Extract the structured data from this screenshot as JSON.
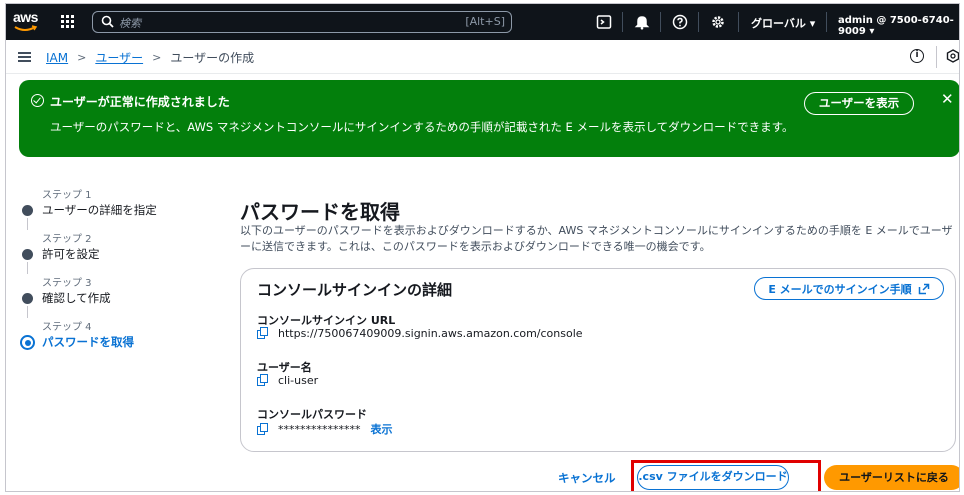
{
  "topnav": {
    "logo": "aws",
    "search_placeholder": "検索",
    "search_shortcut": "[Alt+S]",
    "region": "グローバル ▾",
    "account": "admin @ 7500-6740-9009 ▾"
  },
  "breadcrumb": {
    "items": [
      "IAM",
      "ユーザー",
      "ユーザーの作成"
    ]
  },
  "flash": {
    "title": "ユーザーが正常に作成されました",
    "message": "ユーザーのパスワードと、AWS マネジメントコンソールにサインインするための手順が記載された E メールを表示してダウンロードできます。",
    "view_user_button": "ユーザーを表示",
    "close": "✕",
    "color": "#037f0c"
  },
  "steps": [
    {
      "num": "ステップ 1",
      "label": "ユーザーの詳細を指定"
    },
    {
      "num": "ステップ 2",
      "label": "許可を設定"
    },
    {
      "num": "ステップ 3",
      "label": "確認して作成"
    },
    {
      "num": "ステップ 4",
      "label": "パスワードを取得"
    }
  ],
  "main": {
    "title": "パスワードを取得",
    "description": "以下のユーザーのパスワードを表示およびダウンロードするか、AWS マネジメントコンソールにサインインするための手順を E メールでユーザーに送信できます。これは、このパスワードを表示およびダウンロードできる唯一の機会です。"
  },
  "card": {
    "title": "コンソールサインインの詳細",
    "email_button": "E メールでのサインイン手順",
    "url_label": "コンソールサインイン URL",
    "url_value": "https://750067409009.signin.aws.amazon.com/console",
    "username_label": "ユーザー名",
    "username_value": "cli-user",
    "password_label": "コンソールパスワード",
    "password_value": "***************",
    "show_link": "表示"
  },
  "footer": {
    "cancel": "キャンセル",
    "download_csv": ".csv ファイルをダウンロード",
    "return_to_list": "ユーザーリストに戻る",
    "primary_color": "#ff9900",
    "highlight_color": "#e00000"
  }
}
